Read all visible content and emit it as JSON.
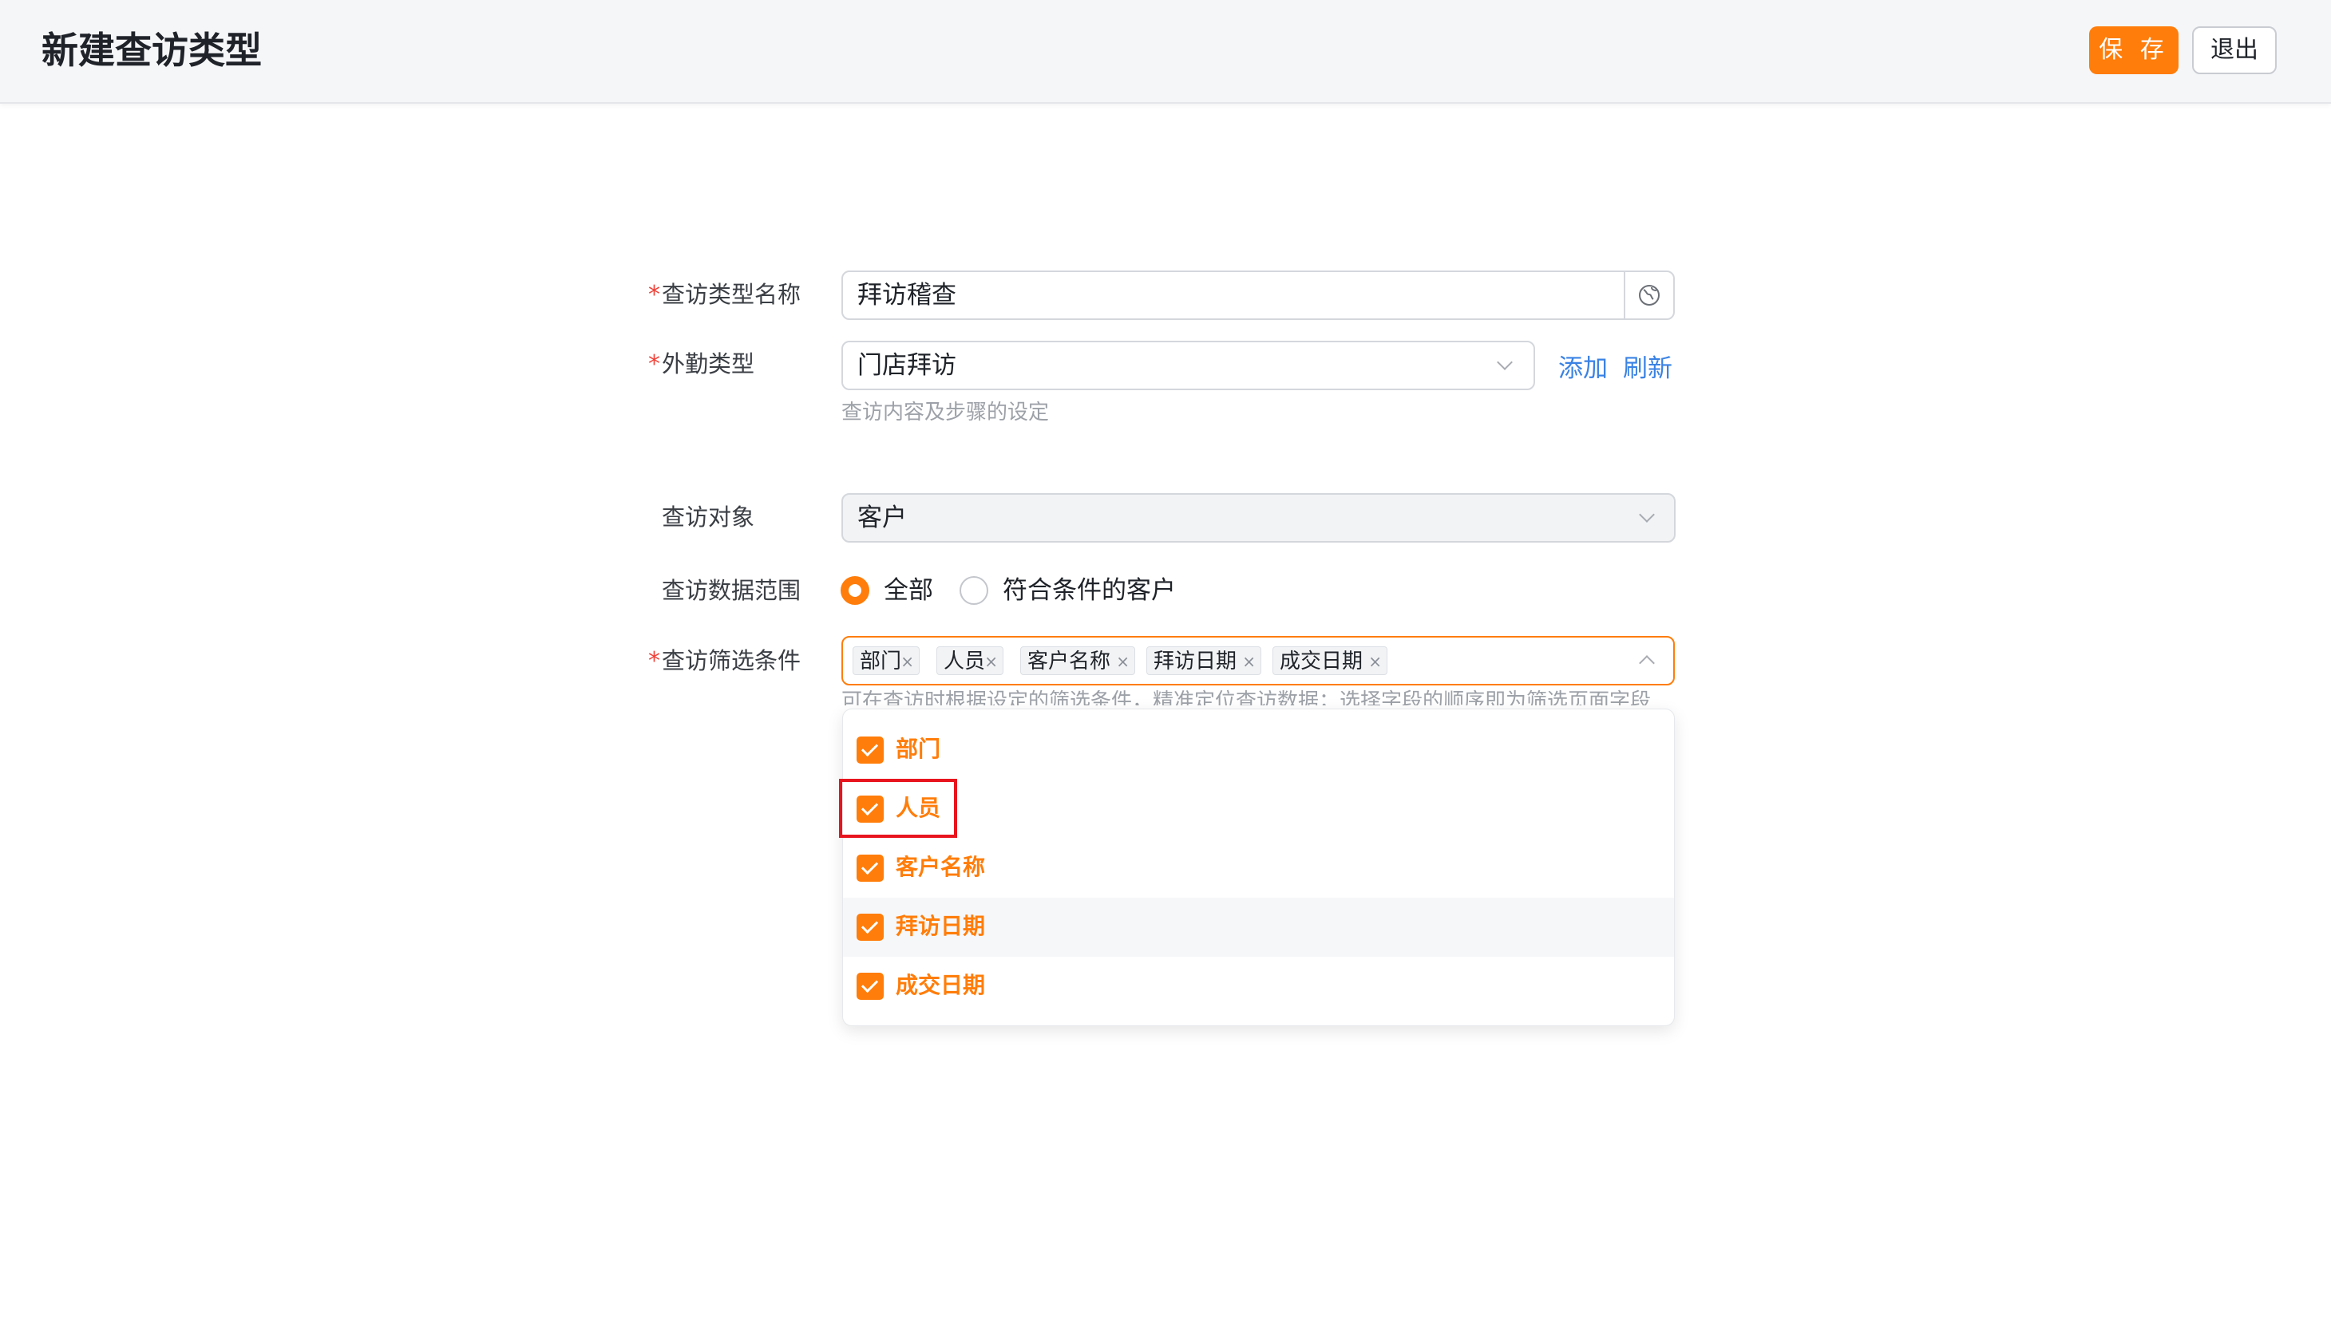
{
  "page": {
    "title": "新建查访类型"
  },
  "toolbar": {
    "save_label": "保 存",
    "exit_label": "退出"
  },
  "form": {
    "name": {
      "label": "查访类型名称",
      "value": "拜访稽查"
    },
    "field_type": {
      "label": "外勤类型",
      "value": "门店拜访",
      "add_link": "添加",
      "refresh_link": "刷新",
      "hint": "查访内容及步骤的设定"
    },
    "target": {
      "label": "查访对象",
      "value": "客户"
    },
    "range": {
      "label": "查访数据范围",
      "options": [
        "全部",
        "符合条件的客户"
      ],
      "selected": "全部"
    },
    "filters": {
      "label": "查访筛选条件",
      "tags": [
        "部门",
        "人员",
        "客户名称",
        "拜访日期",
        "成交日期"
      ],
      "hint": "可在查访时根据设定的筛选条件，精准定位查访数据；选择字段的顺序即为筛选页面字段"
    }
  },
  "dropdown": {
    "options": [
      {
        "label": "部门",
        "checked": true
      },
      {
        "label": "人员",
        "checked": true
      },
      {
        "label": "客户名称",
        "checked": true
      },
      {
        "label": "拜访日期",
        "checked": true
      },
      {
        "label": "成交日期",
        "checked": true
      }
    ]
  },
  "colors": {
    "accent": "#ff7d0a",
    "link": "#3a82e4",
    "required": "#f0433a",
    "highlight_box": "#e8141e"
  }
}
